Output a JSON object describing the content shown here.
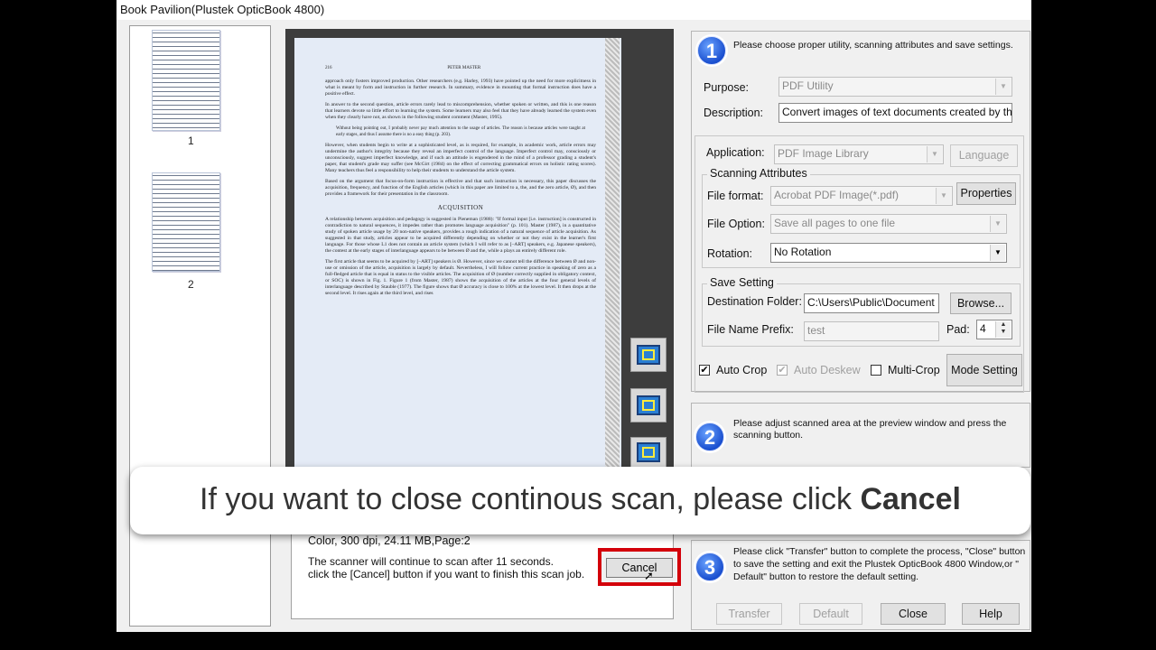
{
  "window": {
    "title": "Book Pavilion(Plustek OpticBook 4800)"
  },
  "thumbnails": [
    {
      "label": "1"
    },
    {
      "label": "2"
    }
  ],
  "scanned_page": {
    "header_left": "216",
    "header_right": "PETER MASTER",
    "paragraphs": [
      "approach only fosters improved production. Other researchers (e.g. Harley, 1993) have pointed up the need for more explicitness in what is meant by form and instruction in further research. In summary, evidence in mounting that formal instruction does have a positive effect.",
      "In answer to the second question, article errors rarely lead to miscomprehension, whether spoken or written, and this is one reason that learners devote so little effort to learning the system. Some learners may also feel that they have already learned the system even when they clearly have not, as shown in the following student comment (Master, 1995).",
      "Without being pointing out, I probably never pay much attention to the usage of articles. The reason is because articles were taught at early stages, and thus I assume there is no a easy thing (p. 203).",
      "However, when students begin to write at a sophisticated level, as is required, for example, in academic work, article errors may undermine the author's integrity because they reveal an imperfect control of the language. Imperfect control may, consciously or unconsciously, suggest imperfect knowledge, and if such an attitude is engendered in the mind of a professor grading a student's paper, that student's grade may suffer (see McGirt (1984) on the effect of correcting grammatical errors on holistic rating scores). Many teachers thus feel a responsibility to help their students to understand the article system.",
      "Based on the argument that focus-on-form instruction is effective and that such instruction is necessary, this paper discusses the acquisition, frequency, and function of the English articles (which in this paper are limited to a, the, and the zero article, Ø), and then provides a framework for their presentation in the classroom."
    ],
    "heading": "ACQUISITION",
    "paragraphs2": [
      "A relationship between acquisition and pedagogy is suggested in Pieneman (1988): \"If formal input [i.e. instruction] is constructed in contradiction to natural sequences, it impedes rather than promotes language acquisition\" (p. 101). Master (1987), in a quantitative study of spoken article usage by 20 non-native speakers, provides a rough indication of a natural sequence of article acquisition. As suggested in that study, articles appear to be acquired differently depending on whether or not they exist in the learner's first language. For those whose L1 does not contain an article system (which I will refer to as [–ART] speakers, e.g. Japanese speakers), the contest at the early stages of interlanguage appears to be between Ø and the, while a plays an entirely different role.",
      "The first article that seems to be acquired by [–ART] speakers is Ø. However, since we cannot tell the difference between Ø and non-use or omission of the article, acquisition is largely by default. Nevertheless, I will follow current practice in speaking of zero as a full-fledged article that is equal in status to the visible articles. The acquisition of Ø (number correctly supplied in obligatory context, or SOC) is shown in Fig. 1. Figure 1 (from Master, 1987) shows the acquisition of the articles at the four general levels of interlanguage described by Stauble (1977). The figure shows that Ø accuracy is close to 100% at the lowest level. It then drops at the second level. It rises again at the third level, and rises"
    ]
  },
  "status": {
    "info": "Color,  300 dpi,  24.11 MB,Page:2",
    "message_line1": "The scanner will continue to scan after 11 seconds.",
    "message_line2": "click the [Cancel] button if you want to finish this scan job.",
    "cancel_label": "Cancel"
  },
  "step1": {
    "number": "1",
    "instruction": "Please choose proper utility, scanning attributes and save settings.",
    "purpose_label": "Purpose:",
    "purpose_value": "PDF Utility",
    "description_label": "Description:",
    "description_value": "Convert images of text documents created by the",
    "application_label": "Application:",
    "application_value": "PDF Image Library",
    "language_label": "Language",
    "scanning_attributes_label": "Scanning Attributes",
    "file_format_label": "File format:",
    "file_format_value": "Acrobat PDF Image(*.pdf)",
    "properties_label": "Properties",
    "file_option_label": "File Option:",
    "file_option_value": "Save all pages to one file",
    "rotation_label": "Rotation:",
    "rotation_value": "No Rotation",
    "save_setting_label": "Save Setting",
    "dest_folder_label": "Destination Folder:",
    "dest_folder_value": "C:\\Users\\Public\\Document",
    "browse_label": "Browse...",
    "prefix_label": "File Name Prefix:",
    "prefix_value": "test",
    "pad_label": "Pad:",
    "pad_value": "4",
    "auto_crop_label": "Auto Crop",
    "auto_deskew_label": "Auto Deskew",
    "multi_crop_label": "Multi-Crop",
    "mode_setting_label": "Mode Setting"
  },
  "step2": {
    "number": "2",
    "instruction_line1": "Please adjust scanned area at the preview window and press the",
    "instruction_line2": "scanning button."
  },
  "step3": {
    "number": "3",
    "instruction_line1": "Please click \"Transfer\" button to complete the process, \"Close\" button",
    "instruction_line2": "to save the setting and exit the Plustek OpticBook 4800 Window,or \"",
    "instruction_line3": "Default\" button to restore the default setting.",
    "transfer_label": "Transfer",
    "default_label": "Default",
    "close_label": "Close",
    "help_label": "Help"
  },
  "overlay": {
    "text": "If you want to close continous scan, please click ",
    "bold": "Cancel"
  }
}
